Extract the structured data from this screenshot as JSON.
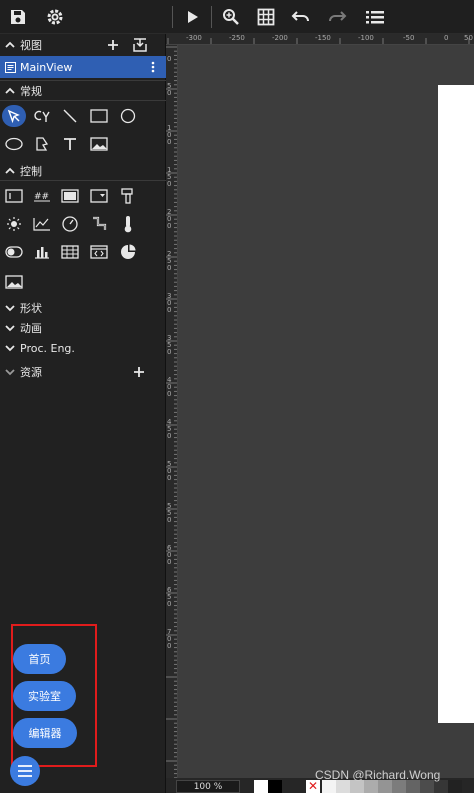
{
  "toolbar": {
    "icons": [
      "save-icon",
      "settings-icon",
      "play-icon",
      "zoom-icon",
      "grid-icon",
      "undo-icon",
      "redo-icon",
      "list-icon"
    ]
  },
  "sidebar": {
    "views_section": {
      "label": "视图"
    },
    "mainview": {
      "label": "MainView"
    },
    "general_section": {
      "label": "常规"
    },
    "controls_section": {
      "label": "控制"
    },
    "shapes_section": {
      "label": "形状"
    },
    "animation_section": {
      "label": "动画"
    },
    "proc_section": {
      "label": "Proc. Eng."
    },
    "resources_section": {
      "label": "资源"
    }
  },
  "floating_menu": {
    "home_label": "首页",
    "lab_label": "实验室",
    "editor_label": "编辑器"
  },
  "ruler": {
    "h_ticks": [
      "-300",
      "-250",
      "-200",
      "-150",
      "-100",
      "-50",
      "0",
      "50"
    ],
    "v_ticks": [
      "50",
      "100",
      "150",
      "200",
      "250",
      "300",
      "350",
      "400",
      "450",
      "500",
      "550",
      "600",
      "650",
      "700"
    ],
    "v_top_tick": "0"
  },
  "status": {
    "zoom": "100 %"
  },
  "watermark": "CSDN @Richard.Wong",
  "colors": {
    "accent": "#2f5fb3",
    "button": "#3b7be0",
    "highlight_box": "#e01c1c"
  }
}
